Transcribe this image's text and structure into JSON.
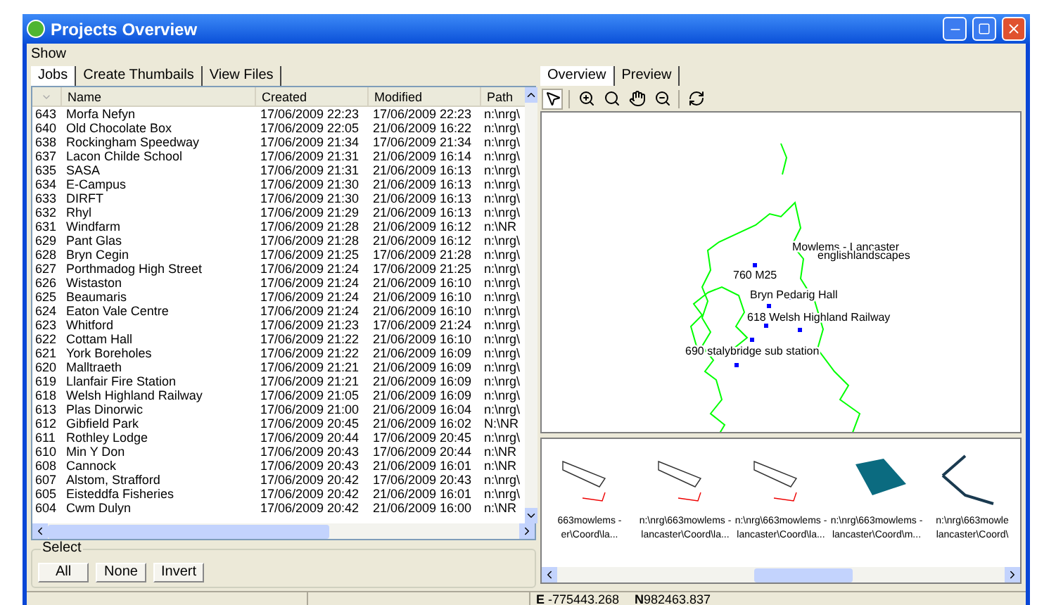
{
  "window": {
    "title": "Projects Overview"
  },
  "menu": [
    "Show"
  ],
  "left_tabs": [
    {
      "label": "Jobs",
      "selected": true
    },
    {
      "label": "Create Thumbails",
      "selected": false
    },
    {
      "label": "View Files",
      "selected": false
    }
  ],
  "table": {
    "columns": [
      "Name",
      "Created",
      "Modified",
      "Path"
    ],
    "rows": [
      {
        "id": "643",
        "name": "Morfa Nefyn",
        "created": "17/06/2009 22:23",
        "modified": "17/06/2009 22:23",
        "path": "n:\\nrg\\"
      },
      {
        "id": "640",
        "name": "Old Chocolate Box",
        "created": "17/06/2009 22:05",
        "modified": "21/06/2009 16:22",
        "path": "n:\\nrg\\"
      },
      {
        "id": "638",
        "name": "Rockingham Speedway",
        "created": "17/06/2009 21:34",
        "modified": "17/06/2009 21:34",
        "path": "n:\\nrg\\"
      },
      {
        "id": "637",
        "name": "Lacon Childe School",
        "created": "17/06/2009 21:31",
        "modified": "21/06/2009 16:14",
        "path": "n:\\nrg\\"
      },
      {
        "id": "635",
        "name": "SASA",
        "created": "17/06/2009 21:31",
        "modified": "21/06/2009 16:13",
        "path": "n:\\nrg\\"
      },
      {
        "id": "634",
        "name": "E-Campus",
        "created": "17/06/2009 21:30",
        "modified": "21/06/2009 16:13",
        "path": "n:\\nrg\\"
      },
      {
        "id": "633",
        "name": "DIRFT",
        "created": "17/06/2009 21:30",
        "modified": "21/06/2009 16:13",
        "path": "n:\\nrg\\"
      },
      {
        "id": "632",
        "name": "Rhyl",
        "created": "17/06/2009 21:29",
        "modified": "21/06/2009 16:13",
        "path": "n:\\nrg\\"
      },
      {
        "id": "631",
        "name": "Windfarm",
        "created": "17/06/2009 21:28",
        "modified": "21/06/2009 16:12",
        "path": "n:\\NR"
      },
      {
        "id": "629",
        "name": "Pant Glas",
        "created": "17/06/2009 21:28",
        "modified": "21/06/2009 16:12",
        "path": "n:\\nrg\\"
      },
      {
        "id": "628",
        "name": "Bryn Cegin",
        "created": "17/06/2009 21:25",
        "modified": "17/06/2009 21:28",
        "path": "n:\\nrg\\"
      },
      {
        "id": "627",
        "name": "Porthmadog High Street",
        "created": "17/06/2009 21:24",
        "modified": "17/06/2009 21:25",
        "path": "n:\\nrg\\"
      },
      {
        "id": "626",
        "name": "Wistaston",
        "created": "17/06/2009 21:24",
        "modified": "21/06/2009 16:10",
        "path": "n:\\nrg\\"
      },
      {
        "id": "625",
        "name": "Beaumaris",
        "created": "17/06/2009 21:24",
        "modified": "21/06/2009 16:10",
        "path": "n:\\nrg\\"
      },
      {
        "id": "624",
        "name": "Eaton Vale Centre",
        "created": "17/06/2009 21:24",
        "modified": "21/06/2009 16:10",
        "path": "n:\\nrg\\"
      },
      {
        "id": "623",
        "name": "Whitford",
        "created": "17/06/2009 21:23",
        "modified": "17/06/2009 21:24",
        "path": "n:\\nrg\\"
      },
      {
        "id": "622",
        "name": "Cottam Hall",
        "created": "17/06/2009 21:22",
        "modified": "21/06/2009 16:10",
        "path": "n:\\nrg\\"
      },
      {
        "id": "621",
        "name": "York Boreholes",
        "created": "17/06/2009 21:22",
        "modified": "21/06/2009 16:09",
        "path": "n:\\nrg\\"
      },
      {
        "id": "620",
        "name": "Malltraeth",
        "created": "17/06/2009 21:21",
        "modified": "21/06/2009 16:09",
        "path": "n:\\nrg\\"
      },
      {
        "id": "619",
        "name": "Llanfair Fire Station",
        "created": "17/06/2009 21:21",
        "modified": "21/06/2009 16:09",
        "path": "n:\\nrg\\"
      },
      {
        "id": "618",
        "name": "Welsh Highland Railway",
        "created": "17/06/2009 21:05",
        "modified": "21/06/2009 16:09",
        "path": "n:\\nrg\\"
      },
      {
        "id": "613",
        "name": "Plas Dinorwic",
        "created": "17/06/2009 21:00",
        "modified": "21/06/2009 16:04",
        "path": "n:\\nrg\\"
      },
      {
        "id": "612",
        "name": "Gibfield Park",
        "created": "17/06/2009 20:45",
        "modified": "21/06/2009 16:02",
        "path": "N:\\NR"
      },
      {
        "id": "611",
        "name": "Rothley Lodge",
        "created": "17/06/2009 20:44",
        "modified": "17/06/2009 20:45",
        "path": "n:\\nrg\\"
      },
      {
        "id": "610",
        "name": "Min Y Don",
        "created": "17/06/2009 20:43",
        "modified": "17/06/2009 20:44",
        "path": "n:\\NR"
      },
      {
        "id": "608",
        "name": "Cannock",
        "created": "17/06/2009 20:43",
        "modified": "21/06/2009 16:01",
        "path": "n:\\NR"
      },
      {
        "id": "607",
        "name": "Alstom, Strafford",
        "created": "17/06/2009 20:42",
        "modified": "17/06/2009 20:43",
        "path": "n:\\nrg\\"
      },
      {
        "id": "605",
        "name": "Eisteddfa Fisheries",
        "created": "17/06/2009 20:42",
        "modified": "21/06/2009 16:01",
        "path": "n:\\nrg\\"
      },
      {
        "id": "604",
        "name": "Cwm Dulyn",
        "created": "17/06/2009 20:42",
        "modified": "21/06/2009 16:00",
        "path": "n:\\NR"
      }
    ]
  },
  "select": {
    "title": "Select",
    "buttons": [
      "All",
      "None",
      "Invert"
    ]
  },
  "right_tabs": [
    {
      "label": "Overview",
      "selected": true
    },
    {
      "label": "Preview",
      "selected": false
    }
  ],
  "toolbar": [
    {
      "kind": "pointer",
      "selected": true
    },
    {
      "kind": "zoom-in",
      "selected": false
    },
    {
      "kind": "zoom-fit",
      "selected": false
    },
    {
      "kind": "pan",
      "selected": false
    },
    {
      "kind": "zoom-out",
      "selected": false
    },
    {
      "kind": "refresh",
      "selected": false
    }
  ],
  "map": {
    "labels": [
      "Mowlems - Lancaster",
      "englishlandscapes",
      "760 M25",
      "Bryn Pedarig Hall",
      "618 Welsh Highland Railway",
      "690 stalybridge sub station"
    ]
  },
  "thumbnails": [
    {
      "line1": "663mowlems -",
      "line2": "er\\Coord\\la..."
    },
    {
      "line1": "n:\\nrg\\663mowlems -",
      "line2": "lancaster\\Coord\\la..."
    },
    {
      "line1": "n:\\nrg\\663mowlems -",
      "line2": "lancaster\\Coord\\la..."
    },
    {
      "line1": "n:\\nrg\\663mowlems -",
      "line2": "lancaster\\Coord\\m..."
    },
    {
      "line1": "n:\\nrg\\663mowle",
      "line2": "lancaster\\Coord\\"
    }
  ],
  "status_bar": {
    "easting": "**E** -775443.268",
    "northing": "**N**982463.837"
  }
}
